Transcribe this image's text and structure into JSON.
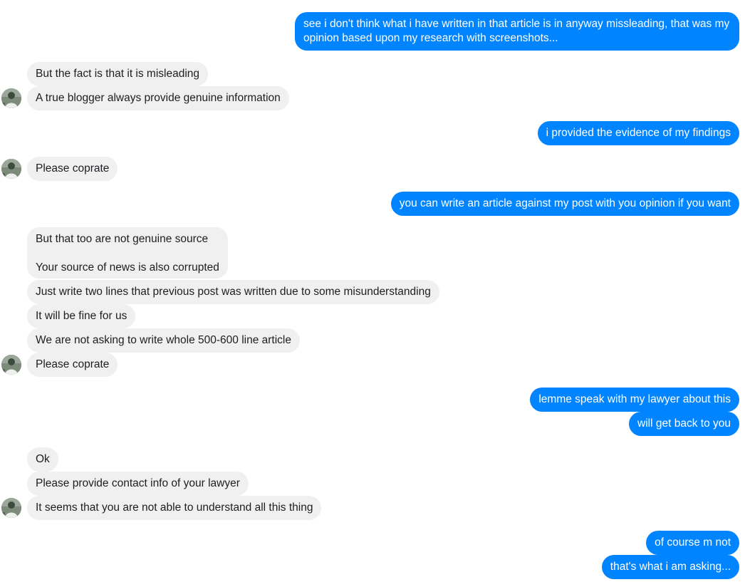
{
  "conversation": {
    "messages": [
      {
        "sender": "me",
        "text": "see i don't think what i have written in that article is in anyway missleading, that was my opinion based upon my research with screenshots..."
      },
      {
        "sender": "them",
        "text": "But the fact is that it is misleading"
      },
      {
        "sender": "them",
        "text": "A true blogger always provide genuine information"
      },
      {
        "sender": "me",
        "text": "i provided the evidence of my findings"
      },
      {
        "sender": "them",
        "text": "Please coprate"
      },
      {
        "sender": "me",
        "text": "you can write an article against my post with you opinion if you want"
      },
      {
        "sender": "them",
        "text": "But that too are not genuine source",
        "text2": "Your source of news is also corrupted"
      },
      {
        "sender": "them",
        "text": "Just write two lines that previous post was written due to some misunderstanding"
      },
      {
        "sender": "them",
        "text": "It will be fine for us"
      },
      {
        "sender": "them",
        "text": "We are not asking to write whole 500-600 line article"
      },
      {
        "sender": "them",
        "text": "Please coprate"
      },
      {
        "sender": "me",
        "text": "lemme speak with my lawyer about this"
      },
      {
        "sender": "me",
        "text": "will get back to you"
      },
      {
        "sender": "them",
        "text": "Ok"
      },
      {
        "sender": "them",
        "text": "Please provide contact info of your lawyer"
      },
      {
        "sender": "them",
        "text": "It seems that you are not able to understand all this thing"
      },
      {
        "sender": "me",
        "text": "of course m not"
      },
      {
        "sender": "me",
        "text": "that's what i am asking..."
      }
    ]
  },
  "colors": {
    "outgoing_bubble": "#0084ff",
    "incoming_bubble": "#f1f0f0",
    "outgoing_text": "#ffffff",
    "incoming_text": "#1c1e21"
  },
  "icons": {
    "avatar": "contact-avatar-icon"
  }
}
